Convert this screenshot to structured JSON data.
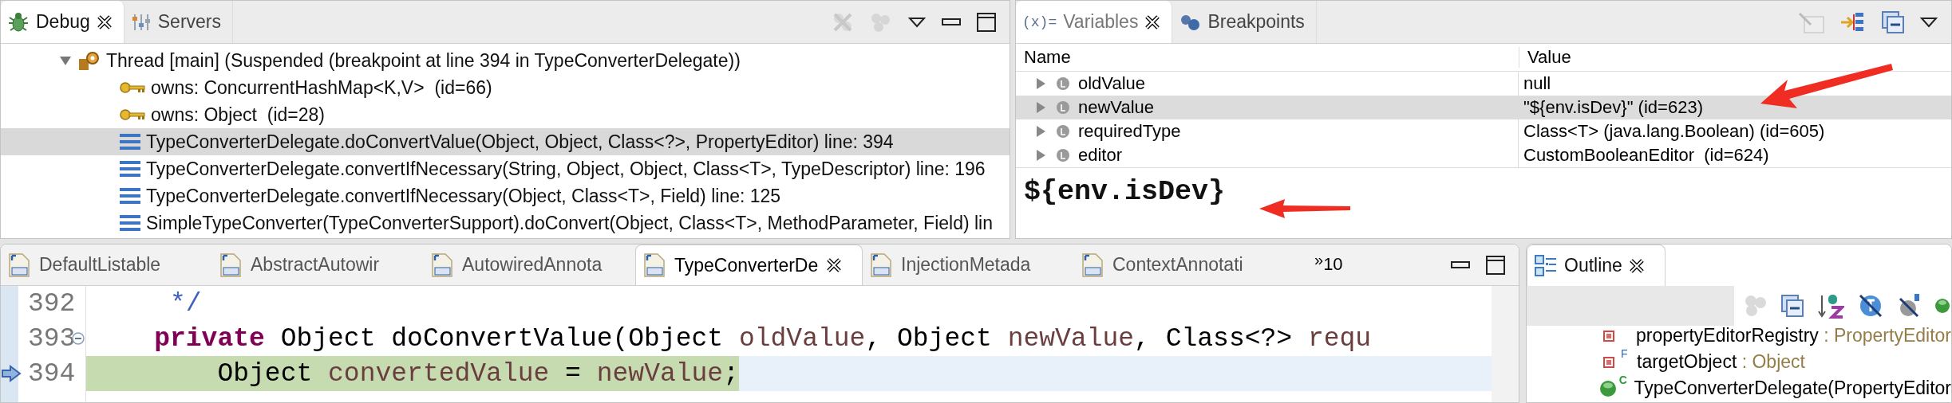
{
  "debug": {
    "tabs": [
      {
        "label": "Debug",
        "selected": true
      },
      {
        "label": "Servers",
        "selected": false
      }
    ],
    "thread": {
      "label": "Thread [main] (Suspended (breakpoint at line 394 in TypeConverterDelegate))",
      "expanded": true,
      "children": [
        {
          "kind": "monitor",
          "label": "owns: ConcurrentHashMap<K,V>  (id=66)",
          "selected": false
        },
        {
          "kind": "monitor",
          "label": "owns: Object  (id=28)",
          "selected": false
        },
        {
          "kind": "frame",
          "label": "TypeConverterDelegate.doConvertValue(Object, Object, Class<?>, PropertyEditor) line: 394",
          "selected": true
        },
        {
          "kind": "frame",
          "label": "TypeConverterDelegate.convertIfNecessary(String, Object, Object, Class<T>, TypeDescriptor) line: 196",
          "selected": false
        },
        {
          "kind": "frame",
          "label": "TypeConverterDelegate.convertIfNecessary(Object, Class<T>, Field) line: 125",
          "selected": false
        },
        {
          "kind": "frame",
          "label": "SimpleTypeConverter(TypeConverterSupport).doConvert(Object, Class<T>, MethodParameter, Field) lin",
          "selected": false
        }
      ]
    }
  },
  "variables": {
    "tabs": [
      {
        "icon_label": "(x)=",
        "label": "Variables",
        "selected": true
      },
      {
        "label": "Breakpoints",
        "selected": false
      }
    ],
    "columns": [
      "Name",
      "Value"
    ],
    "rows": [
      {
        "name": "oldValue",
        "value": "null",
        "selected": false
      },
      {
        "name": "newValue",
        "value": "\"${env.isDev}\" (id=623)",
        "selected": true
      },
      {
        "name": "requiredType",
        "value": "Class<T> (java.lang.Boolean) (id=605)",
        "selected": false
      },
      {
        "name": "editor",
        "value": "CustomBooleanEditor  (id=624)",
        "selected": false
      }
    ],
    "detail": "${env.isDev}"
  },
  "editor": {
    "tabs": [
      {
        "label": "DefaultListable",
        "selected": false
      },
      {
        "label": "AbstractAutowir",
        "selected": false
      },
      {
        "label": "AutowiredAnnota",
        "selected": false
      },
      {
        "label": "TypeConverterDe",
        "selected": true
      },
      {
        "label": "InjectionMetada",
        "selected": false
      },
      {
        "label": "ContextAnnotati",
        "selected": false
      }
    ],
    "overflow_mark": "»",
    "overflow_count": "10",
    "lines": [
      {
        "number": "392",
        "current": false,
        "foldable": false,
        "tokens": [
          {
            "kind": "comment",
            "text": "     */"
          }
        ]
      },
      {
        "number": "393",
        "current": false,
        "foldable": true,
        "tokens": [
          {
            "kind": "keyword",
            "text": "    private"
          },
          {
            "kind": "plain",
            "text": " Object doConvertValue(Object "
          },
          {
            "kind": "variable",
            "text": "oldValue"
          },
          {
            "kind": "plain",
            "text": ", Object "
          },
          {
            "kind": "variable",
            "text": "newValue"
          },
          {
            "kind": "plain",
            "text": ", Class<?> "
          },
          {
            "kind": "variable",
            "text": "requ"
          }
        ]
      },
      {
        "number": "394",
        "current": true,
        "foldable": false,
        "tokens": [
          {
            "kind": "plain",
            "text": "        Object "
          },
          {
            "kind": "variable",
            "text": "convertedValue"
          },
          {
            "kind": "plain",
            "text": " = "
          },
          {
            "kind": "variable",
            "text": "newValue"
          },
          {
            "kind": "plain",
            "text": ";"
          }
        ]
      }
    ]
  },
  "outline": {
    "tab": "Outline",
    "items": [
      {
        "kind": "field",
        "name": "propertyEditorRegistry",
        "type": " : PropertyEditor"
      },
      {
        "kind": "field",
        "marker": "F",
        "name": "targetObject",
        "type": " : Object"
      },
      {
        "kind": "constructor",
        "marker": "C",
        "name": "TypeConverterDelegate(PropertyEditor"
      }
    ]
  }
}
